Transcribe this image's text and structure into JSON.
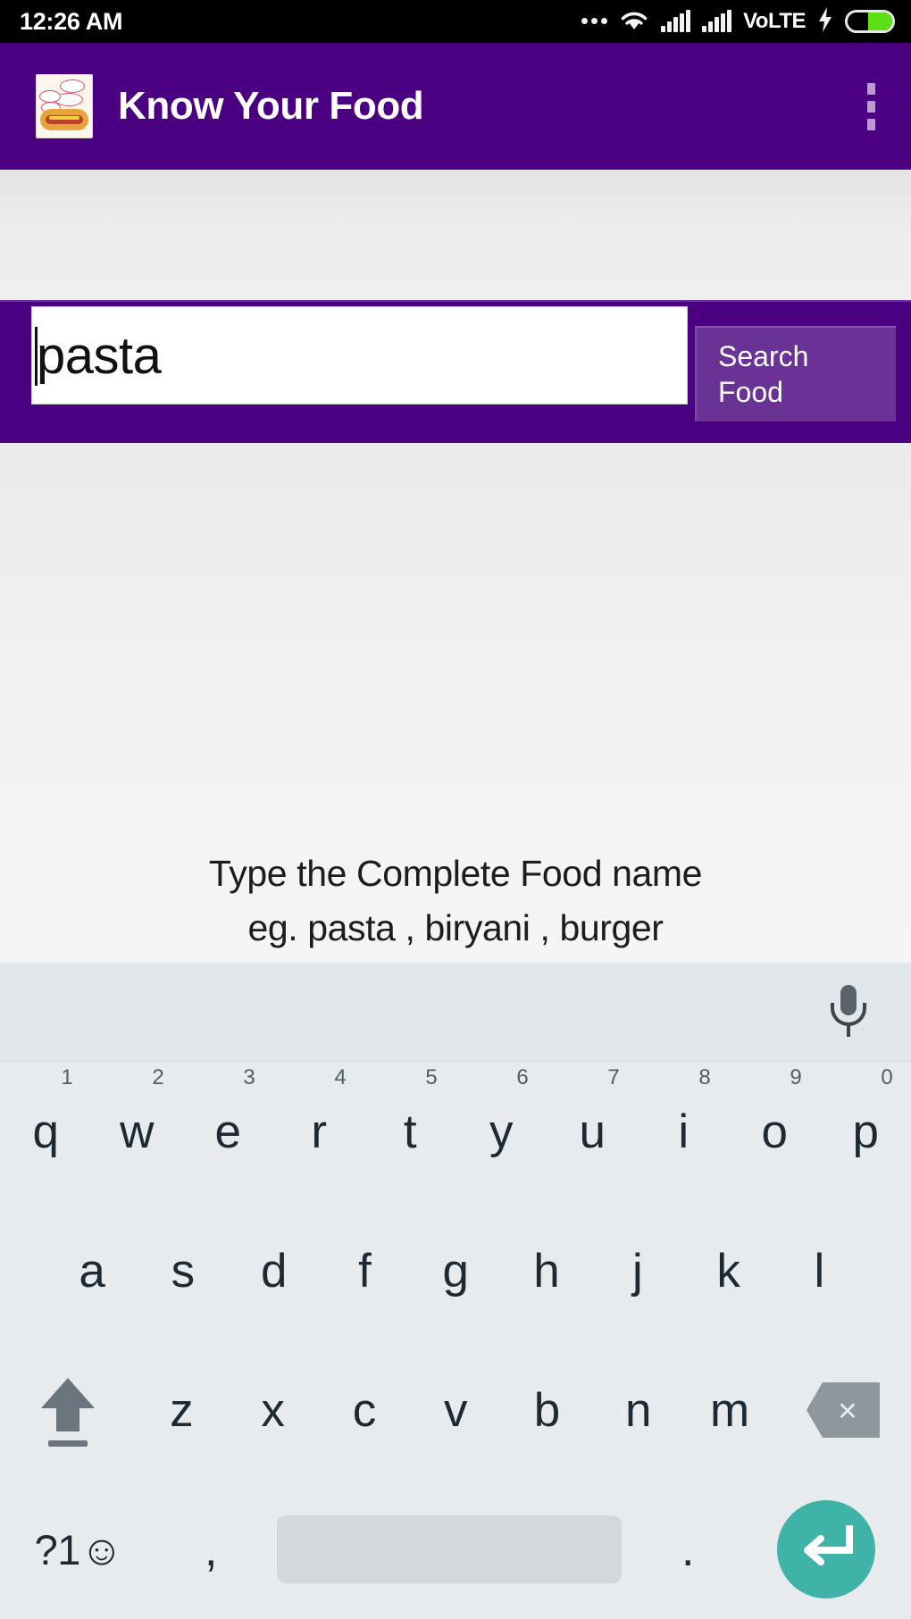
{
  "status_bar": {
    "clock": "12:26 AM",
    "network_label": "VoLTE",
    "icons": [
      "more-dots-icon",
      "wifi-icon",
      "signal-icon",
      "signal-icon",
      "charging-bolt-icon",
      "battery-icon"
    ],
    "battery_level_percent": 55,
    "battery_fill_color": "#5ce016",
    "background_color": "#000000"
  },
  "app_bar": {
    "title": "Know Your Food",
    "app_icon_name": "hotdog-app-icon",
    "overflow_menu_label": "More options",
    "background_color": "#4a0080",
    "title_color": "#ffffff"
  },
  "search": {
    "input_value": "pasta",
    "input_placeholder": "Type the Complete Food name",
    "button_label_line1": "Search",
    "button_label_line2": "Food",
    "button_color": "#6b3296",
    "band_color": "#4a0080"
  },
  "main": {
    "hint_line1": "Type the Complete Food name",
    "hint_line2": "eg. pasta , biryani , burger",
    "background_color": "#f1f1f1"
  },
  "keyboard": {
    "background_color": "#e7ebee",
    "suggestion_strip": {
      "mic_icon_name": "microphone-icon",
      "background_color": "#e1e6ea"
    },
    "row1": [
      {
        "key": "q",
        "num": "1"
      },
      {
        "key": "w",
        "num": "2"
      },
      {
        "key": "e",
        "num": "3"
      },
      {
        "key": "r",
        "num": "4"
      },
      {
        "key": "t",
        "num": "5"
      },
      {
        "key": "y",
        "num": "6"
      },
      {
        "key": "u",
        "num": "7"
      },
      {
        "key": "i",
        "num": "8"
      },
      {
        "key": "o",
        "num": "9"
      },
      {
        "key": "p",
        "num": "0"
      }
    ],
    "row2": [
      "a",
      "s",
      "d",
      "f",
      "g",
      "h",
      "j",
      "k",
      "l"
    ],
    "row3": {
      "shift_label": "shift-key",
      "letters": [
        "z",
        "x",
        "c",
        "v",
        "b",
        "n",
        "m"
      ],
      "backspace_label": "backspace-key",
      "backspace_glyph": "×"
    },
    "row4": {
      "symbols_label": "?1☺",
      "comma_label": ",",
      "space_label": "space",
      "period_label": ".",
      "enter_label": "enter-key",
      "enter_color": "#3fb3a7"
    }
  }
}
